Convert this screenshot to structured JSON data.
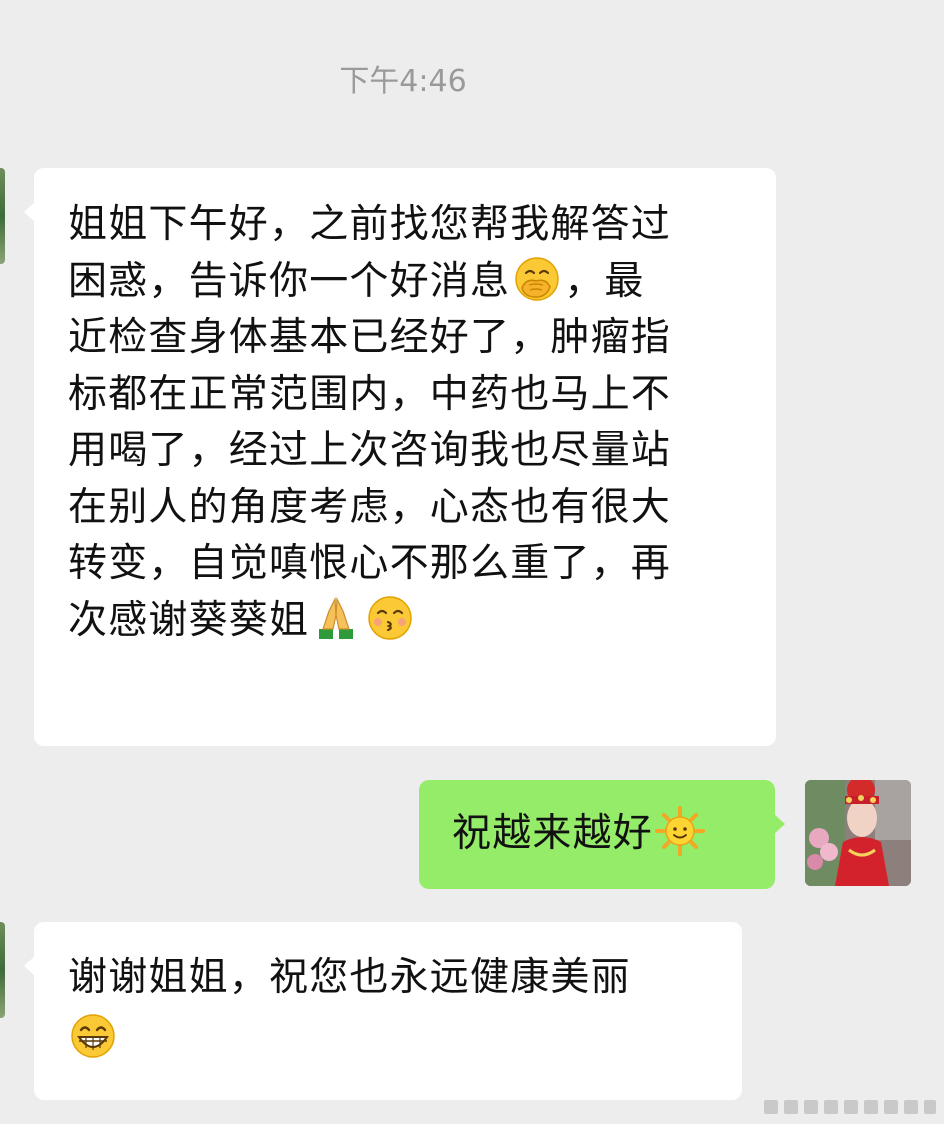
{
  "chat": {
    "timestamp": "下午4:46",
    "messages": [
      {
        "direction": "incoming",
        "text_main": "姐姐下午好，之前找您帮我解答过\n困惑，告诉你一个好消息",
        "emoji_1": "face-with-hand-over-mouth",
        "text_2": "，最\n近检查身体基本已经好了，肿瘤指\n标都在正常范围内，中药也马上不\n用喝了，经过上次咨询我也尽量站\n在别人的角度考虑，心态也有很大\n转变，自觉嗔恨心不那么重了，再\n次感谢葵葵姐",
        "emoji_2": "folded-hands",
        "emoji_3": "kissing-face-with-smiling-eyes"
      },
      {
        "direction": "outgoing",
        "text": "祝越来越好",
        "emoji": "sun-with-face"
      },
      {
        "direction": "incoming",
        "text": "谢谢姐姐，祝您也永远健康美丽",
        "emoji": "grinning-face-with-smiling-eyes"
      }
    ]
  },
  "colors": {
    "background": "#ededed",
    "incoming_bubble": "#ffffff",
    "outgoing_bubble": "#95ec69",
    "timestamp_text": "#9a9a9a",
    "text": "#111111"
  }
}
